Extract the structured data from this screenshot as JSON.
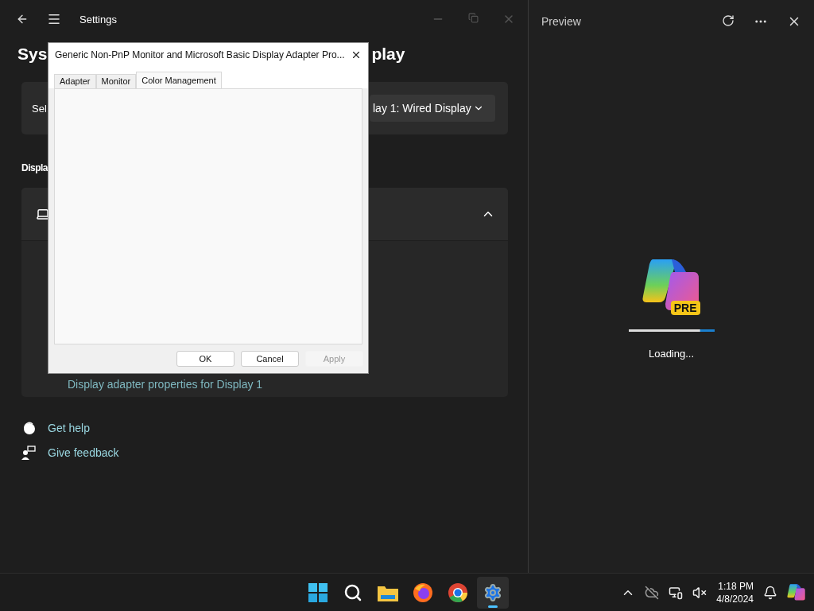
{
  "settings_window": {
    "title": "Settings",
    "heading_parts": [
      "Sys",
      "play"
    ],
    "display_selector": {
      "label": "Sel",
      "value": "lay 1: Wired Display"
    },
    "section_title": "Displa",
    "expander": {
      "expanded": true,
      "link": "Display adapter properties for Display 1"
    },
    "links": [
      {
        "kind": "help",
        "label": "Get help"
      },
      {
        "kind": "feedback",
        "label": "Give feedback"
      }
    ]
  },
  "dialog": {
    "title": "Generic Non-PnP Monitor and Microsoft Basic Display Adapter Pro...",
    "tabs": [
      {
        "label": "Adapter",
        "selected": false
      },
      {
        "label": "Monitor",
        "selected": false
      },
      {
        "label": "Color Management",
        "selected": true
      }
    ],
    "buttons": [
      {
        "label": "OK",
        "disabled": false
      },
      {
        "label": "Cancel",
        "disabled": false
      },
      {
        "label": "Apply",
        "disabled": true
      }
    ]
  },
  "preview": {
    "title": "Preview",
    "badge": "PRE",
    "progress": {
      "level": 0.83
    },
    "status": "Loading..."
  },
  "taskbar": {
    "apps": [
      {
        "kind": "start",
        "selected": false
      },
      {
        "kind": "search",
        "selected": false
      },
      {
        "kind": "files",
        "selected": false
      },
      {
        "kind": "firefox",
        "selected": false
      },
      {
        "kind": "chrome",
        "selected": false
      },
      {
        "kind": "settings",
        "selected": true
      }
    ],
    "time": "1:18 PM",
    "date": "4/8/2024"
  }
}
